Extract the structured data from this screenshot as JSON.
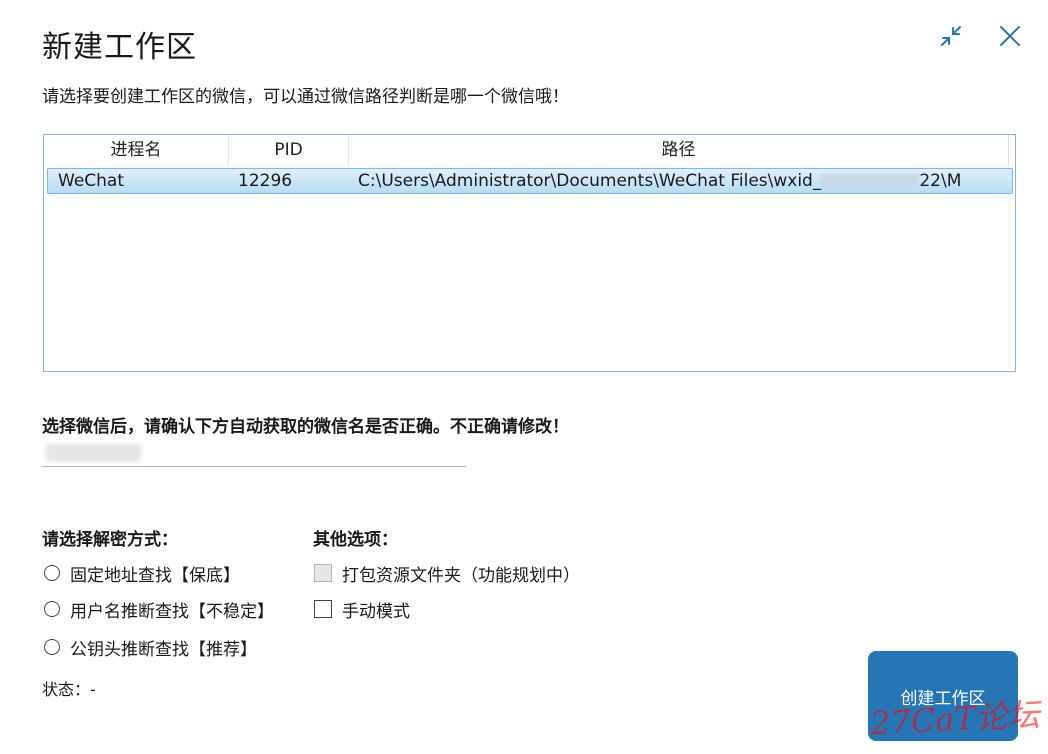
{
  "window": {
    "title": "新建工作区",
    "minimize_icon": "collapse-arrows-icon",
    "close_icon": "close-icon"
  },
  "description": "请选择要创建工作区的微信，可以通过微信路径判断是哪一个微信哦！",
  "process_table": {
    "headers": [
      "进程名",
      "PID",
      "路径"
    ],
    "rows": [
      {
        "name": "WeChat",
        "pid": "12296",
        "path": "C:\\Users\\Administrator\\Documents\\WeChat Files\\wxid_",
        "path_tail": "22\\M"
      }
    ]
  },
  "name_section": {
    "label": "选择微信后，请确认下方自动获取的微信名是否正确。不正确请修改！"
  },
  "decrypt": {
    "label": "请选择解密方式：",
    "options": [
      "固定地址查找【保底】",
      "用户名推断查找【不稳定】",
      "公钥头推断查找【推荐】"
    ]
  },
  "other": {
    "label": "其他选项：",
    "options": [
      "打包资源文件夹（功能规划中）",
      "手动模式"
    ]
  },
  "status": "状态：-",
  "create_button": "创建工作区",
  "watermark": "27CaT论坛",
  "colors": {
    "accent": "#2676b6",
    "selection": "#b8dcf5"
  }
}
